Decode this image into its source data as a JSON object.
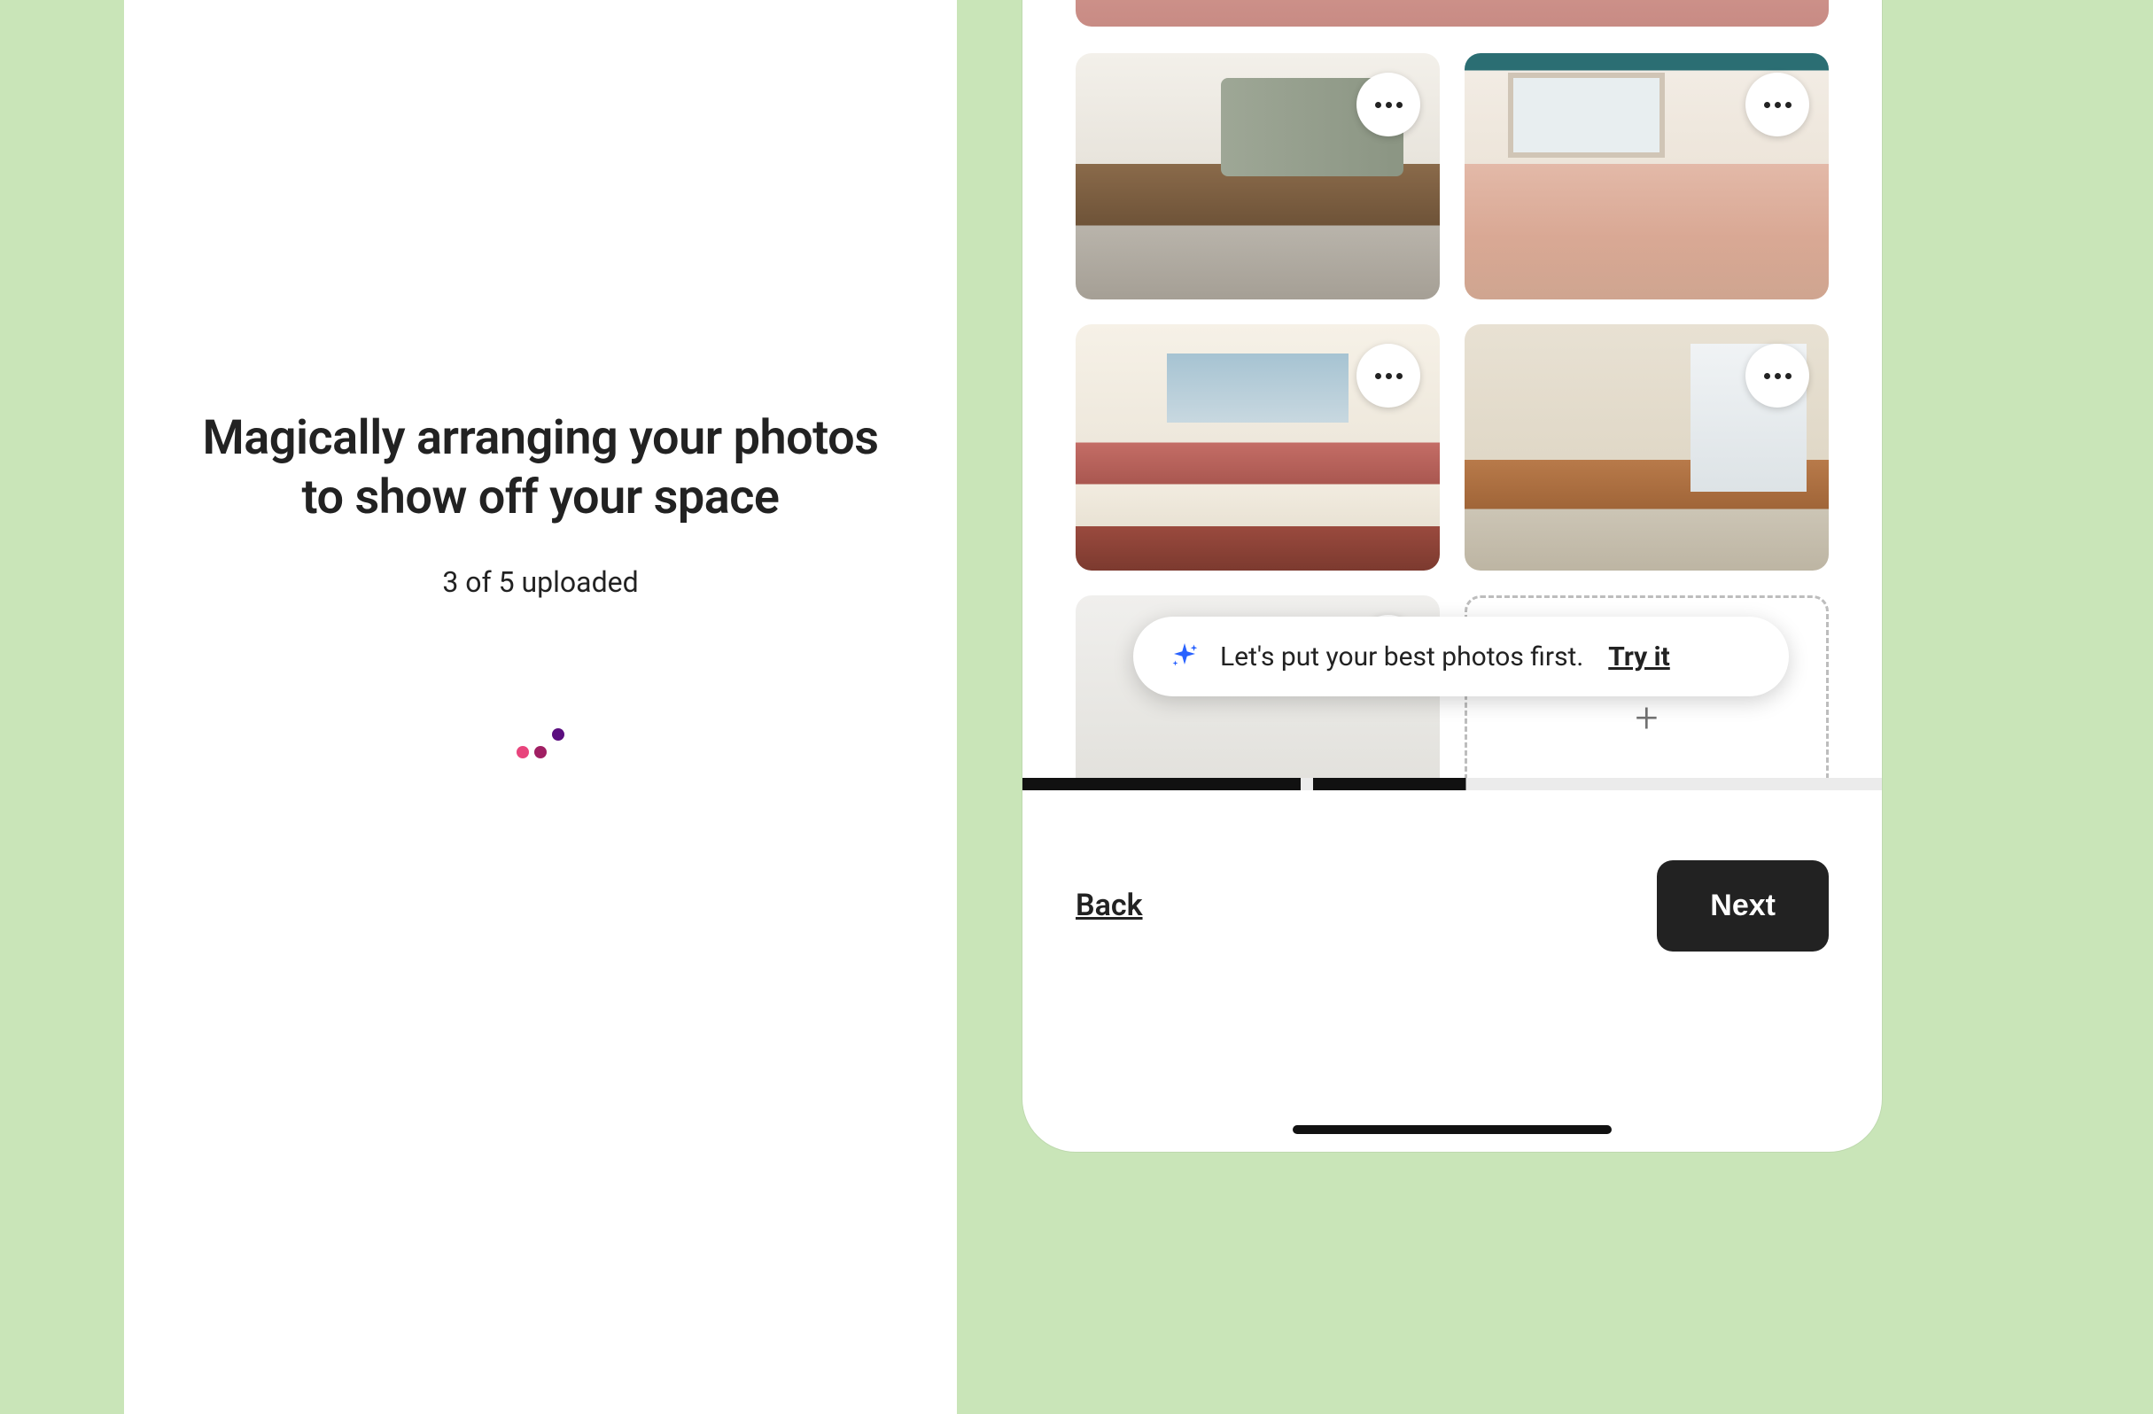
{
  "left": {
    "heading_line1": "Magically arranging your photos",
    "heading_line2": "to show off your space",
    "status": "3 of 5 uploaded"
  },
  "phone": {
    "tooltip": {
      "text": "Let's put your best photos first.",
      "action": "Try it"
    },
    "footer": {
      "back": "Back",
      "next": "Next"
    },
    "grid": {
      "items": [
        {
          "name": "living-room-1"
        },
        {
          "name": "kitchen"
        },
        {
          "name": "living-room-2"
        },
        {
          "name": "living-room-3"
        },
        {
          "name": "blank-room"
        }
      ],
      "add_label": "+"
    },
    "progress": {
      "segments": 3,
      "current": 2
    }
  },
  "colors": {
    "page_bg": "#c9e5b8",
    "accent_pink": "#e8447c",
    "accent_purple": "#5b0e7f",
    "dark": "#222222"
  }
}
